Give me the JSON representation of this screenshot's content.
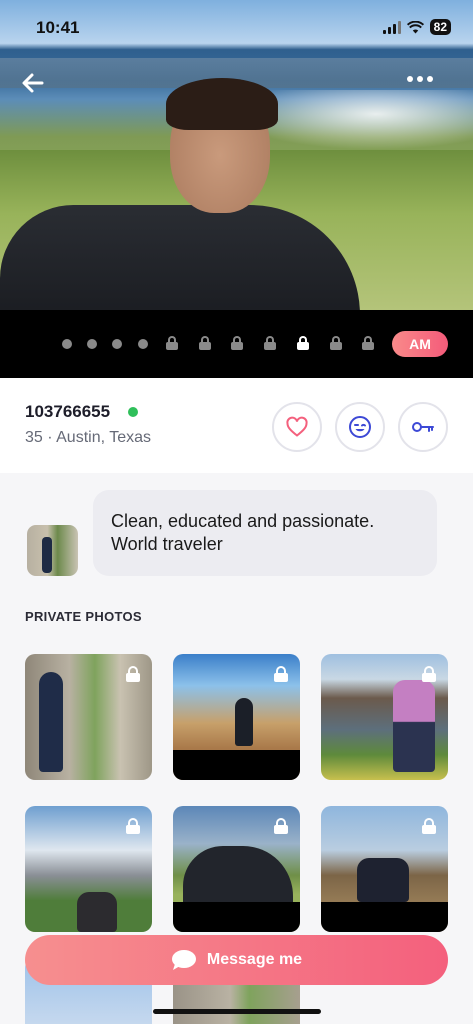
{
  "status_bar": {
    "time": "10:41",
    "battery": "82"
  },
  "photo_pager": {
    "am_label": "AM",
    "dot_count": 4,
    "lock_count": 7,
    "active_lock_index": 4
  },
  "profile": {
    "id": "103766655",
    "meta": "35 · Austin, Texas",
    "online": true
  },
  "bio": {
    "text_line1": "Clean, educated and passionate.",
    "text_line2": "World traveler"
  },
  "private_photos": {
    "title": "PRIVATE PHOTOS"
  },
  "actions": {
    "message_label": "Message me"
  },
  "colors": {
    "accent": "#f4607d",
    "online": "#2fbf5a",
    "icon_blue": "#3d49d6"
  },
  "icons": [
    "back-arrow-icon",
    "more-dots-icon",
    "heart-icon",
    "wink-icon",
    "key-icon",
    "lock-icon",
    "chat-bubble-icon"
  ]
}
